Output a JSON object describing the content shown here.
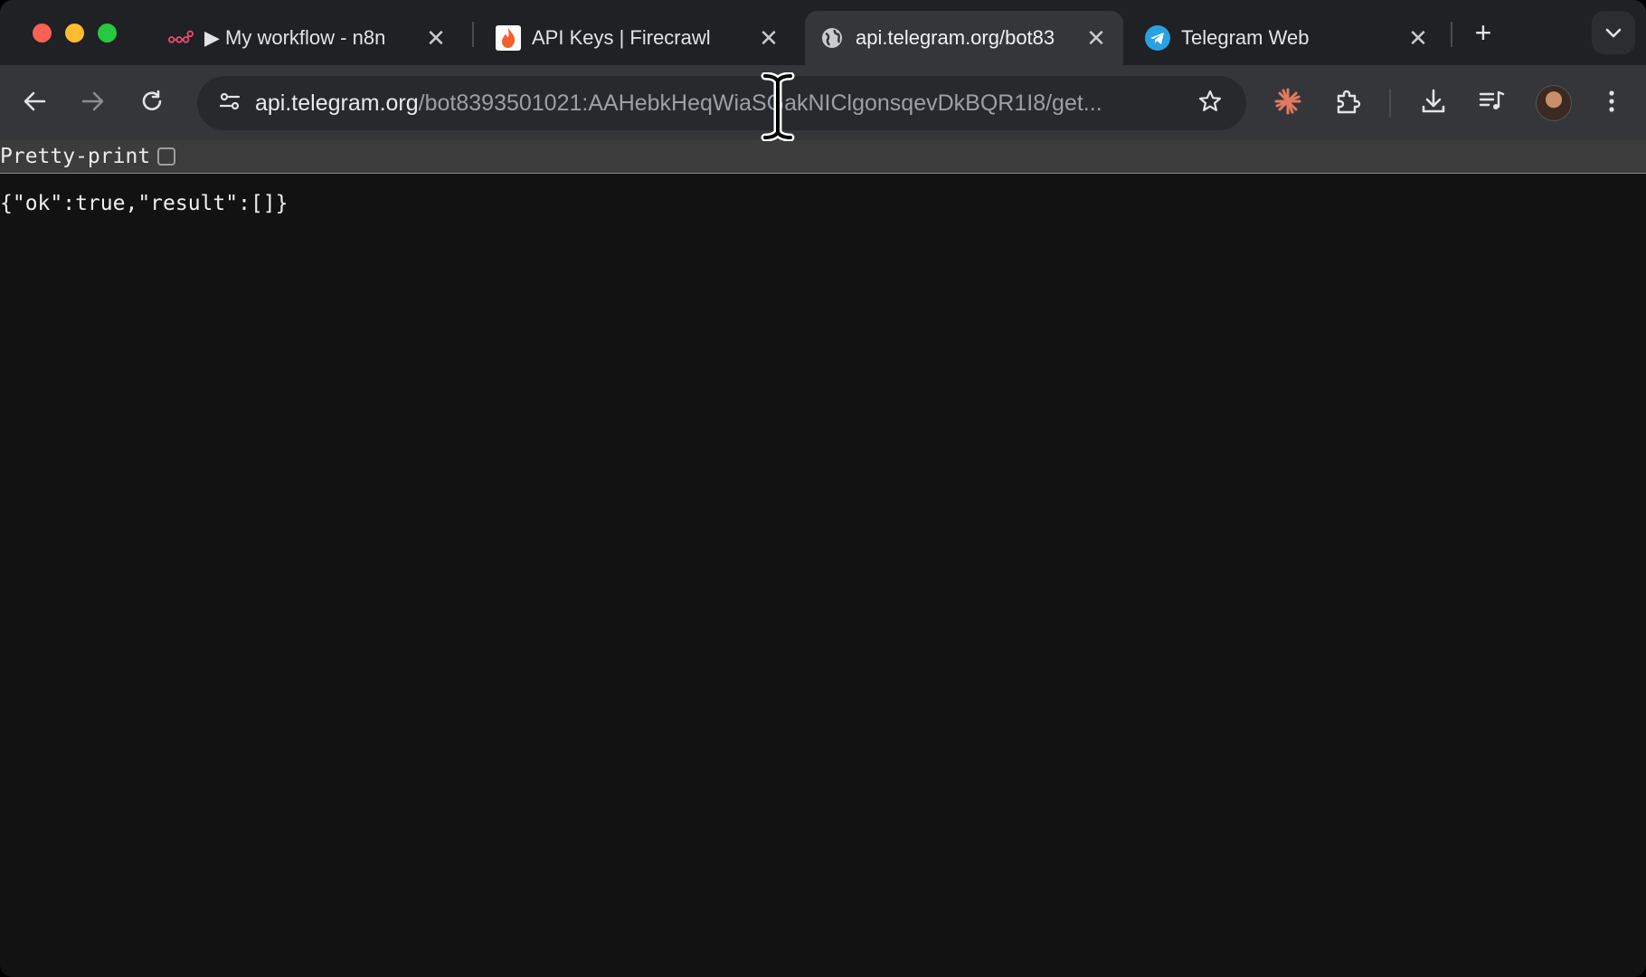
{
  "tabs": [
    {
      "title": "▶ My workflow - n8n",
      "icon": "n8n-logo-icon",
      "close": "✕"
    },
    {
      "title": "API Keys | Firecrawl",
      "icon": "firecrawl-flame-icon",
      "close": "✕"
    },
    {
      "title": "api.telegram.org/bot83",
      "icon": "globe-icon",
      "close": "✕",
      "active": true
    },
    {
      "title": "Telegram Web",
      "icon": "telegram-icon",
      "close": "✕"
    }
  ],
  "newtab": "+",
  "address_bar": {
    "host": "api.telegram.org",
    "path": "/bot8393501021:AAHebkHeqWiaSGakNIClgonsqevDkBQR1I8/get..."
  },
  "pretty_print": {
    "label": "Pretty-print",
    "checked": false
  },
  "response_body": "{\"ok\":true,\"result\":[]}",
  "colors": {
    "traffic_red": "#fe5f57",
    "traffic_yellow": "#febc2e",
    "traffic_green": "#28c840",
    "tab_strip": "#1f2124",
    "toolbar": "#35363a",
    "page_background": "#121212"
  }
}
